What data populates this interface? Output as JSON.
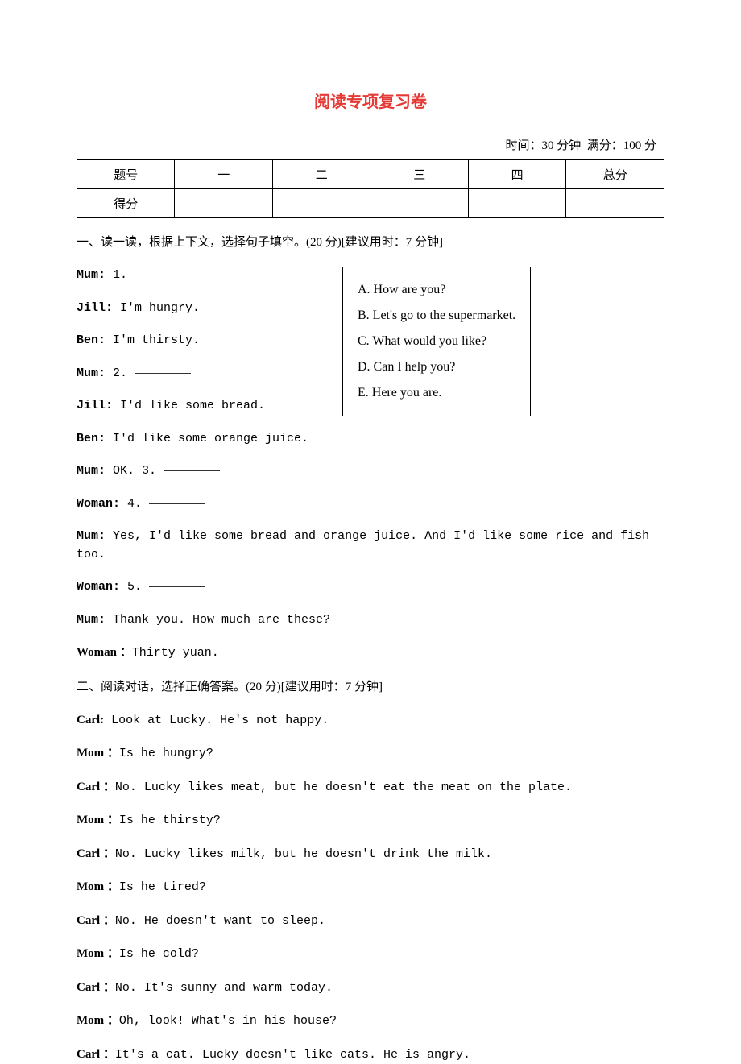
{
  "title": "阅读专项复习卷",
  "meta": {
    "time": "时间：30 分钟",
    "full": "满分：100 分"
  },
  "score_table": {
    "row1": [
      "题号",
      "一",
      "二",
      "三",
      "四",
      "总分"
    ],
    "row2": [
      "得分",
      "",
      "",
      "",
      "",
      ""
    ]
  },
  "section1": {
    "heading": "一、读一读，根据上下文，选择句子填空。(20 分)[建议用时：7 分钟]",
    "options": [
      "A. How are you?",
      "B. Let's go to the supermarket.",
      "C. What would you like?",
      "D. Can I help you?",
      "E. Here you are."
    ],
    "lines": [
      {
        "speaker": "Mum:",
        "text": " 1. ",
        "blank": true
      },
      {
        "speaker": "Jill:",
        "text": " I'm hungry."
      },
      {
        "speaker": "Ben:",
        "text": " I'm thirsty."
      },
      {
        "speaker": "Mum:",
        "text": " 2. ",
        "blank": true
      },
      {
        "speaker": "Jill:",
        "text": " I'd like some bread."
      },
      {
        "speaker": "Ben:",
        "text": " I'd like some orange juice."
      },
      {
        "speaker": "Mum:",
        "text": " OK. 3. ",
        "blank": true
      },
      {
        "speaker": "Woman:",
        "text": " 4. ",
        "blank": true
      },
      {
        "speaker": "Mum:",
        "text": " Yes, I'd like some bread and orange juice. And I'd like some rice and fish too."
      },
      {
        "speaker": "Woman:",
        "text": " 5. ",
        "blank": true
      },
      {
        "speaker": "Mum:",
        "text": " Thank you. How much are these?"
      },
      {
        "speaker": "Woman ：",
        "text": "Thirty yuan."
      }
    ]
  },
  "section2": {
    "heading": "二、阅读对话，选择正确答案。(20 分)[建议用时：7 分钟]",
    "lines": [
      {
        "speaker": "Carl:",
        "text": " Look at Lucky. He's not happy."
      },
      {
        "speaker": "Mom ：",
        "text": "Is he hungry?"
      },
      {
        "speaker": "Carl ：",
        "text": "No. Lucky likes meat, but he doesn't eat the meat on the plate."
      },
      {
        "speaker": "Mom ：",
        "text": "Is he thirsty?"
      },
      {
        "speaker": "Carl ：",
        "text": "No. Lucky likes milk, but he doesn't drink the milk."
      },
      {
        "speaker": "Mom ：",
        "text": "Is he tired?"
      },
      {
        "speaker": "Carl ：",
        "text": "No. He doesn't want to sleep."
      },
      {
        "speaker": "Mom ：",
        "text": "Is he cold?"
      },
      {
        "speaker": "Carl ：",
        "text": "No. It's sunny and warm today."
      },
      {
        "speaker": "Mom ：",
        "text": "Oh, look! What's in his house?"
      },
      {
        "speaker": "Carl ：",
        "text": "It's a cat. Lucky doesn't like cats. He is angry."
      }
    ]
  }
}
